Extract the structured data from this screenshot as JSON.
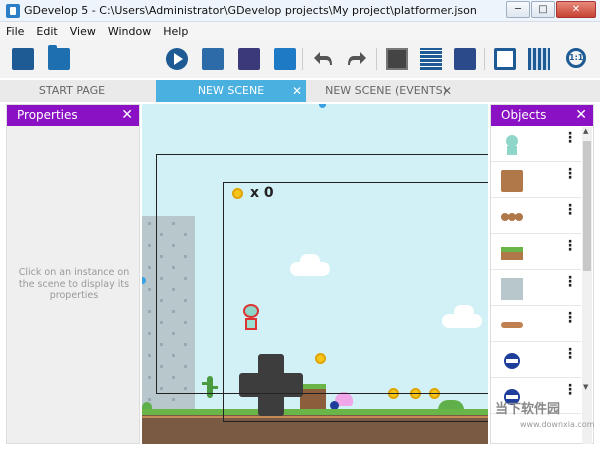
{
  "window": {
    "title": "GDevelop 5 - C:\\Users\\Administrator\\GDevelop projects\\My project\\platformer.json",
    "minimize": "─",
    "maximize": "□",
    "close": "✕"
  },
  "menu": [
    "File",
    "Edit",
    "View",
    "Window",
    "Help"
  ],
  "toolbar": {
    "icons": [
      "project-manager-icon",
      "open-folder-icon",
      "preview-play-icon",
      "add-object-icon",
      "objects-groups-icon",
      "edit-icon",
      "undo-icon",
      "redo-icon",
      "instances-list-icon",
      "layers-icon",
      "scene-properties-icon",
      "window-mask-icon",
      "grid-icon",
      "zoom-icon"
    ],
    "zoom_label": "1:1"
  },
  "tabs": [
    {
      "label": "START PAGE",
      "active": false
    },
    {
      "label": "NEW SCENE",
      "active": true
    },
    {
      "label": "NEW SCENE (EVENTS)",
      "active": false
    }
  ],
  "tab_close": "✕",
  "properties": {
    "title": "Properties",
    "close": "✕",
    "hint": "Click on an instance on the scene to display its properties"
  },
  "scene": {
    "coin_count": "x 0",
    "colors": {
      "sky": "#d2f1f7",
      "grass": "#6ab547",
      "dirt": "#7a5a43",
      "coin": "#f5c517"
    }
  },
  "objects": {
    "title": "Objects",
    "close": "✕",
    "menu_glyph": "⋮",
    "items": [
      {
        "icon": "player-icon"
      },
      {
        "icon": "dirt-block-icon"
      },
      {
        "icon": "bridge-icon"
      },
      {
        "icon": "grass-platform-icon"
      },
      {
        "icon": "stone-block-icon"
      },
      {
        "icon": "log-platform-icon"
      },
      {
        "icon": "blue-orb-icon"
      },
      {
        "icon": "blue-orb-icon"
      }
    ]
  },
  "watermark": {
    "main": "当下软件园",
    "sub": "www.downxia.com"
  }
}
